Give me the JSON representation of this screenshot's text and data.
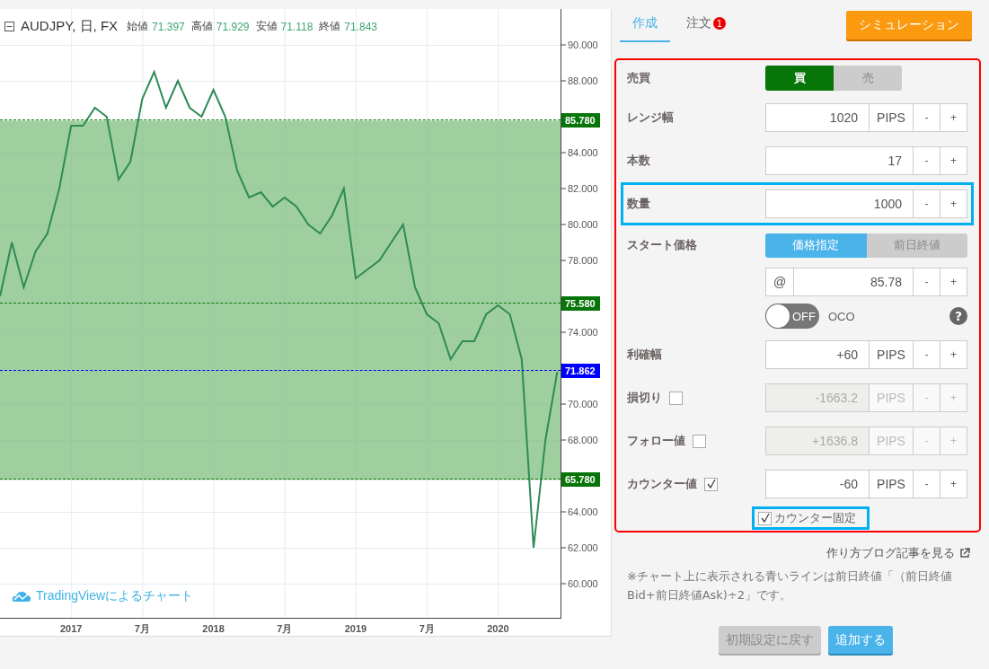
{
  "chart": {
    "symbol": "AUDJPY, 日, FX",
    "ohlc": [
      {
        "label": "始値",
        "value": "71.397"
      },
      {
        "label": "高値",
        "value": "71.929"
      },
      {
        "label": "安値",
        "value": "71.118"
      },
      {
        "label": "終値",
        "value": "71.843"
      }
    ],
    "chart_data": {
      "type": "line",
      "grid": true,
      "categories": [
        null,
        null,
        null,
        null,
        null,
        null,
        "2017",
        null,
        null,
        null,
        null,
        null,
        "7月",
        null,
        null,
        null,
        null,
        null,
        "2018",
        null,
        null,
        null,
        null,
        null,
        "7月",
        null,
        null,
        null,
        null,
        null,
        "2019",
        null,
        null,
        null,
        null,
        null,
        "7月",
        null,
        null,
        null,
        null,
        null,
        "2020",
        null,
        null,
        null,
        null,
        null
      ],
      "series": [
        {
          "color": "#2e8b57",
          "values": [
            76,
            79,
            76.5,
            78.5,
            79.5,
            82,
            85.5,
            85.5,
            86.5,
            86,
            82.5,
            83.5,
            87,
            88.5,
            86.5,
            88,
            86.5,
            86,
            87.5,
            86,
            83,
            81.5,
            81.8,
            81,
            81.5,
            81,
            80,
            79.5,
            80.5,
            82,
            77,
            77.5,
            78,
            79,
            80,
            76.5,
            75,
            74.5,
            72.5,
            73.5,
            73.5,
            75,
            75.5,
            75,
            72.5,
            62,
            68,
            71.8
          ]
        }
      ],
      "ylim": [
        58.1,
        92
      ],
      "yticks": [
        {
          "value": 90,
          "label": "90.000"
        },
        {
          "value": 88,
          "label": "88.000"
        },
        {
          "value": 84,
          "label": "84.000"
        },
        {
          "value": 82,
          "label": "82.000"
        },
        {
          "value": 80,
          "label": "80.000"
        },
        {
          "value": 78,
          "label": "78.000"
        },
        {
          "value": 74,
          "label": "74.000"
        },
        {
          "value": 70,
          "label": "70.000"
        },
        {
          "value": 68,
          "label": "68.000"
        },
        {
          "value": 64,
          "label": "64.000"
        },
        {
          "value": 62,
          "label": "62.000"
        },
        {
          "value": 60,
          "label": "60.000"
        }
      ]
    },
    "markers": [
      {
        "label": "85.780",
        "kind": "top"
      },
      {
        "label": "75.580",
        "kind": "entry"
      },
      {
        "label": "71.862",
        "kind": "close"
      },
      {
        "label": "65.780",
        "kind": "bottom"
      }
    ],
    "credit": "TradingViewによるチャート"
  },
  "tabs": [
    {
      "label": "作成",
      "selected": true
    },
    {
      "label": "注文",
      "selected": false,
      "badge": "1"
    }
  ],
  "simulate_button": "シミュレーション",
  "form": {
    "rows": [
      {
        "kind": "side",
        "label": "売買",
        "highlighted": false,
        "options": [
          {
            "label": "買",
            "selected": true
          },
          {
            "label": "売",
            "selected": false
          }
        ]
      },
      {
        "kind": "number",
        "label": "レンジ幅",
        "highlighted": false,
        "value": "1020",
        "unit": "PIPS",
        "disabled": false,
        "minus": "-",
        "plus": "+"
      },
      {
        "kind": "number",
        "label": "本数",
        "highlighted": false,
        "value": "17",
        "disabled": false,
        "minus": "-",
        "plus": "+"
      },
      {
        "kind": "number",
        "label": "数量",
        "highlighted": true,
        "value": "1000",
        "disabled": false,
        "minus": "-",
        "plus": "+"
      },
      {
        "kind": "source",
        "label": "スタート価格",
        "highlighted": false,
        "options": [
          {
            "label": "価格指定",
            "selected": true
          },
          {
            "label": "前日終値",
            "selected": false
          }
        ]
      },
      {
        "kind": "number",
        "highlighted": false,
        "prefix": "@",
        "value": "85.78",
        "disabled": false,
        "minus": "-",
        "plus": "+"
      },
      {
        "kind": "switch",
        "highlighted": false,
        "switch": {
          "label": "OFF",
          "on": false
        },
        "text": "OCO",
        "help": "?"
      },
      {
        "kind": "number",
        "label": "利確幅",
        "highlighted": false,
        "value": "+60",
        "unit": "PIPS",
        "disabled": false,
        "minus": "-",
        "plus": "+"
      },
      {
        "kind": "number",
        "label": "損切り",
        "checked": false,
        "highlighted": false,
        "value": "-1663.2",
        "unit": "PIPS",
        "disabled": true,
        "minus": "-",
        "plus": "+"
      },
      {
        "kind": "number",
        "label": "フォロー値",
        "checked": false,
        "highlighted": false,
        "value": "+1636.8",
        "unit": "PIPS",
        "disabled": true,
        "minus": "-",
        "plus": "+"
      },
      {
        "kind": "number",
        "label": "カウンター値",
        "checked": true,
        "highlighted": false,
        "value": "-60",
        "unit": "PIPS",
        "disabled": false,
        "minus": "-",
        "plus": "+"
      },
      {
        "kind": "check",
        "label": "カウンター固定",
        "checked": true,
        "highlighted": true
      }
    ]
  },
  "blog_link": "作り方ブログ記事を見る",
  "note": "※チャート上に表示される青いラインは前日終値「（前日終値Bid+前日終値Ask)÷2」です。",
  "buttons": [
    {
      "label": "初期設定に戻す",
      "kind": "reset"
    },
    {
      "label": "追加する",
      "kind": "add"
    }
  ]
}
